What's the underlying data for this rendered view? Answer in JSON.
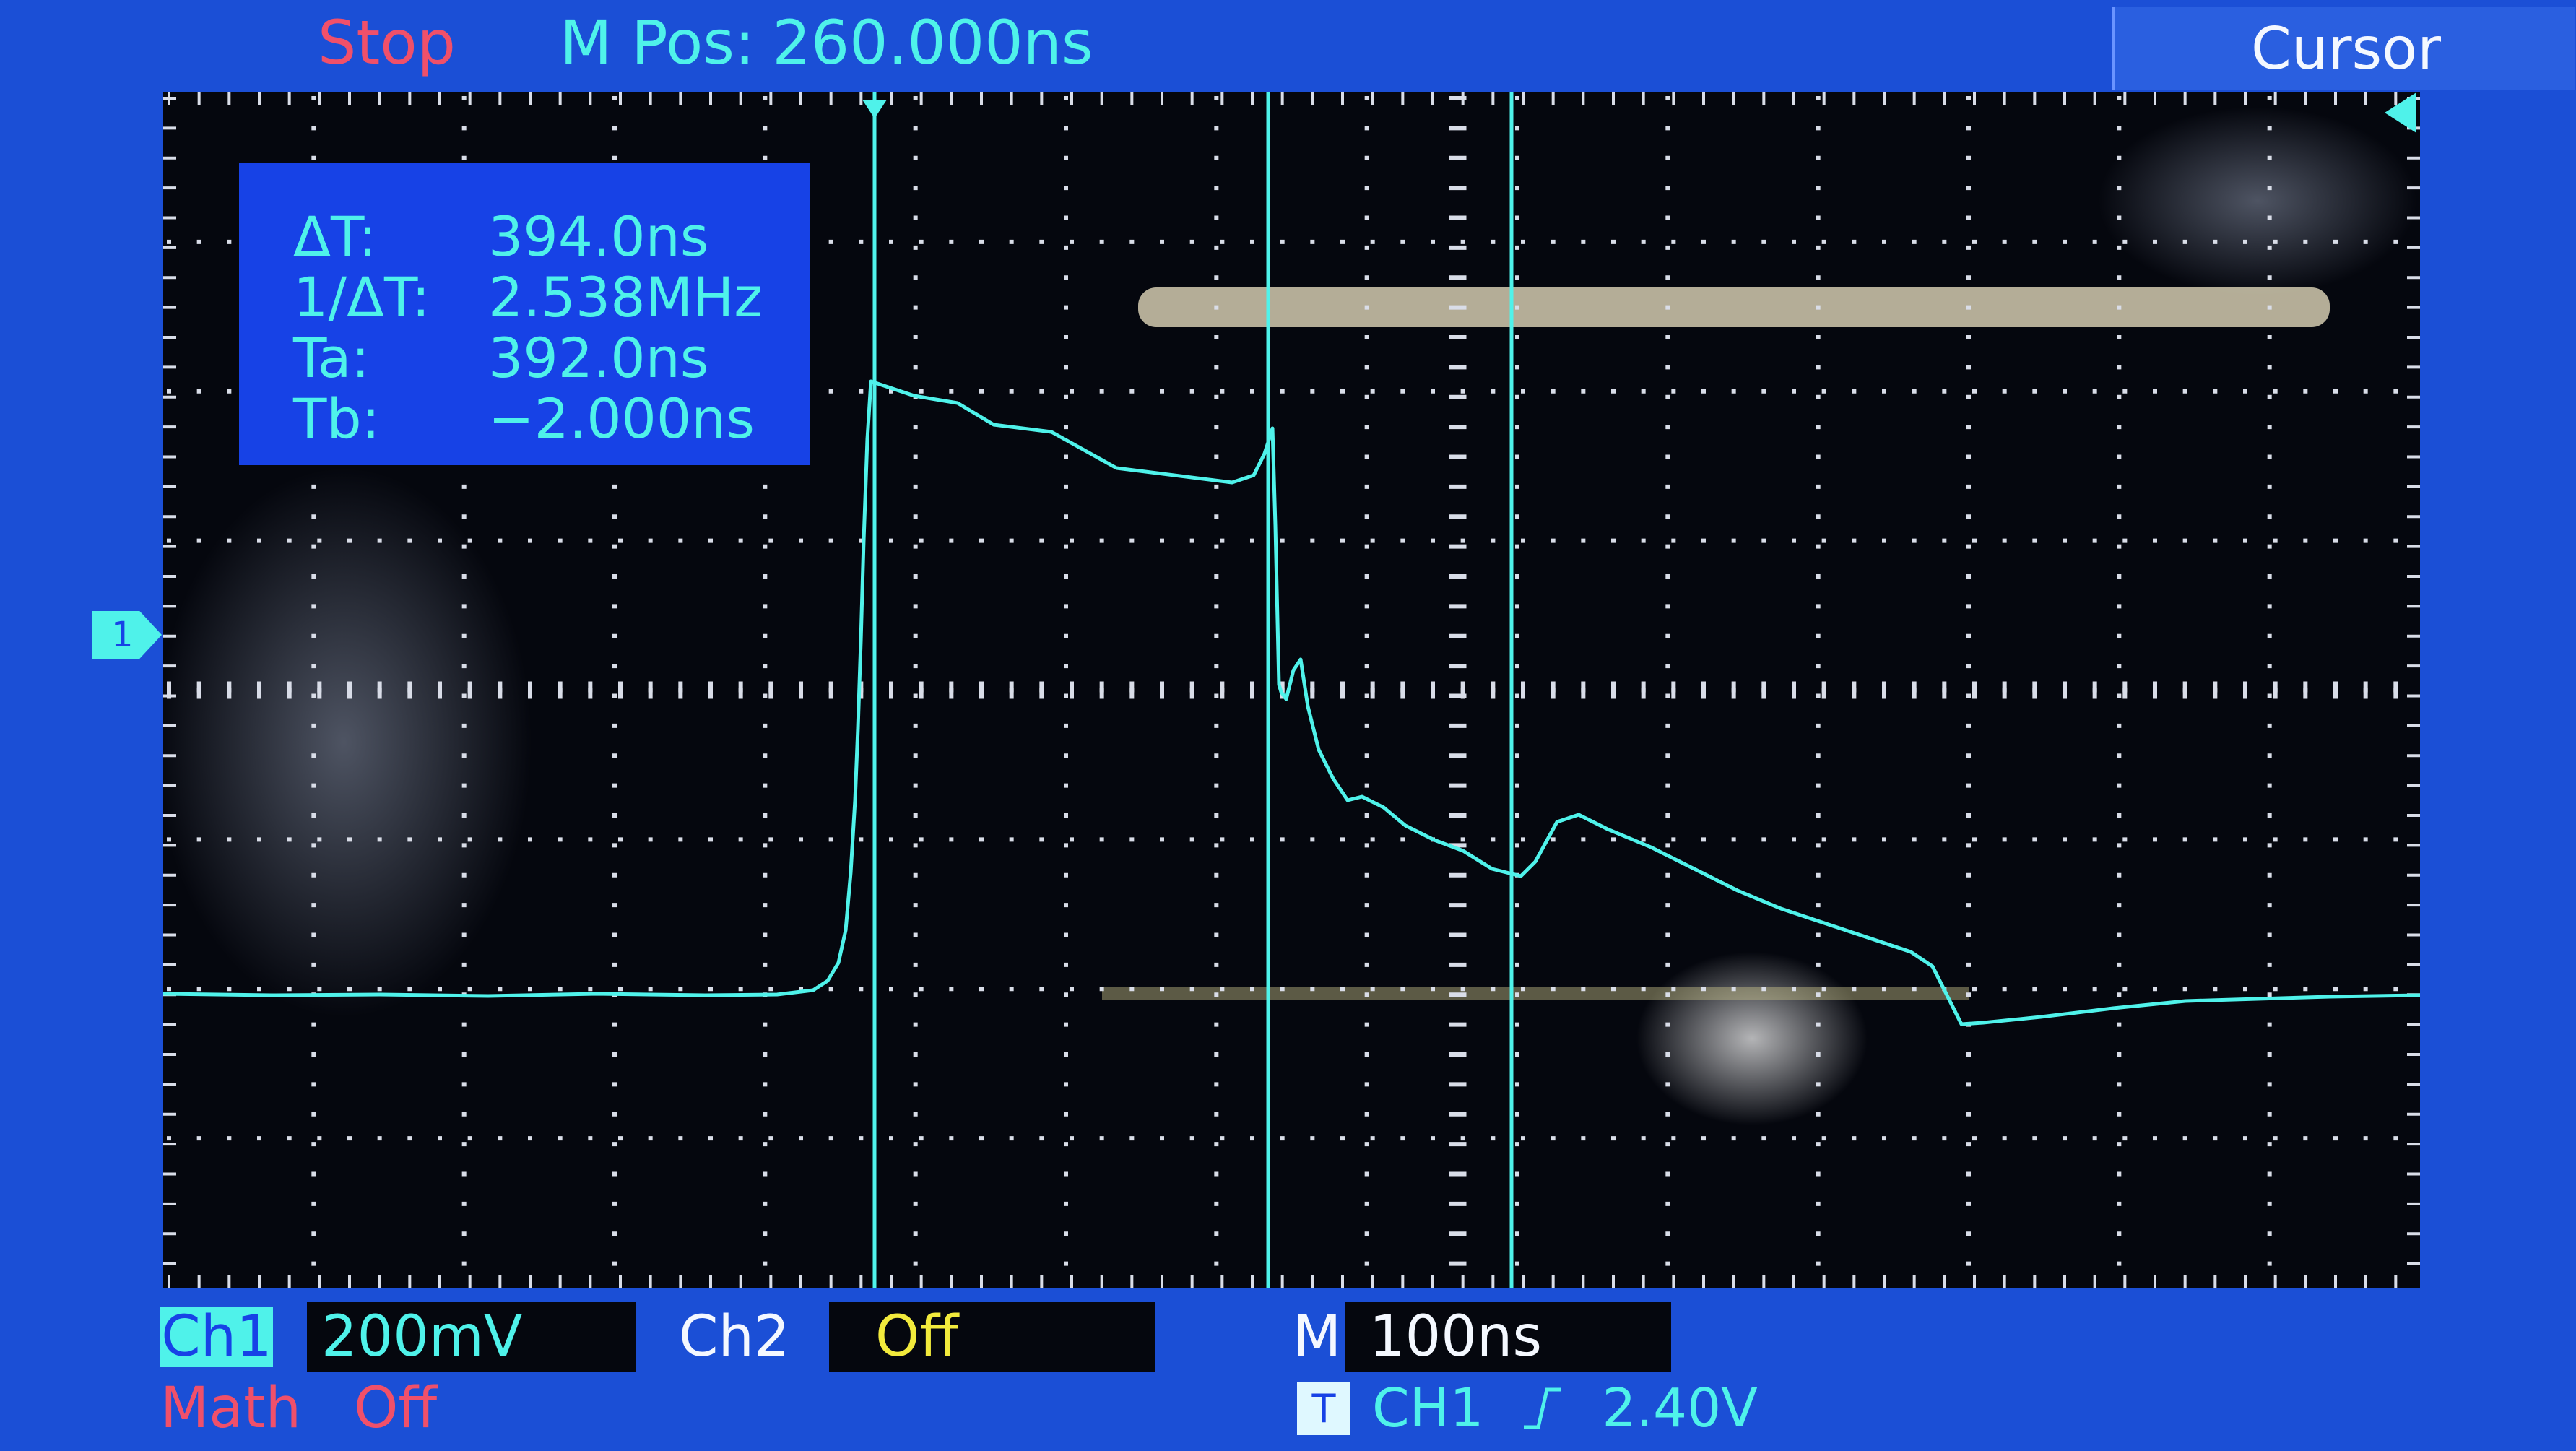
{
  "header": {
    "run_status": "Stop",
    "mpos_label": "M Pos:",
    "mpos_value": "260.000ns",
    "menu_title": "Cursor"
  },
  "readout": {
    "rows": [
      {
        "label": "ΔT:",
        "value": "394.0ns"
      },
      {
        "label": "1/ΔT:",
        "value": "2.538MHz"
      },
      {
        "label": "Ta:",
        "value": "392.0ns"
      },
      {
        "label": "Tb:",
        "value": "−2.000ns"
      }
    ]
  },
  "markers": {
    "ch1_marker": "1"
  },
  "footer": {
    "ch1_label": "Ch1",
    "ch1_scale": "200mV",
    "ch2_label": "Ch2",
    "ch2_state": "Off",
    "timebase_label": "M",
    "timebase_value": "100ns",
    "math_label": "Math",
    "math_state": "Off",
    "trigger_icon": "T",
    "trigger_source": "CH1",
    "trigger_level": "2.40V"
  },
  "icons": {
    "trigger_slope": "rising-edge-icon",
    "trigger_badge": "trigger-icon"
  },
  "colors": {
    "background": "#1b4fd6",
    "trace": "#4ff2ea",
    "stop": "#f0506a",
    "ch2_off": "#f2ea3c",
    "panel": "#1742e6"
  }
}
